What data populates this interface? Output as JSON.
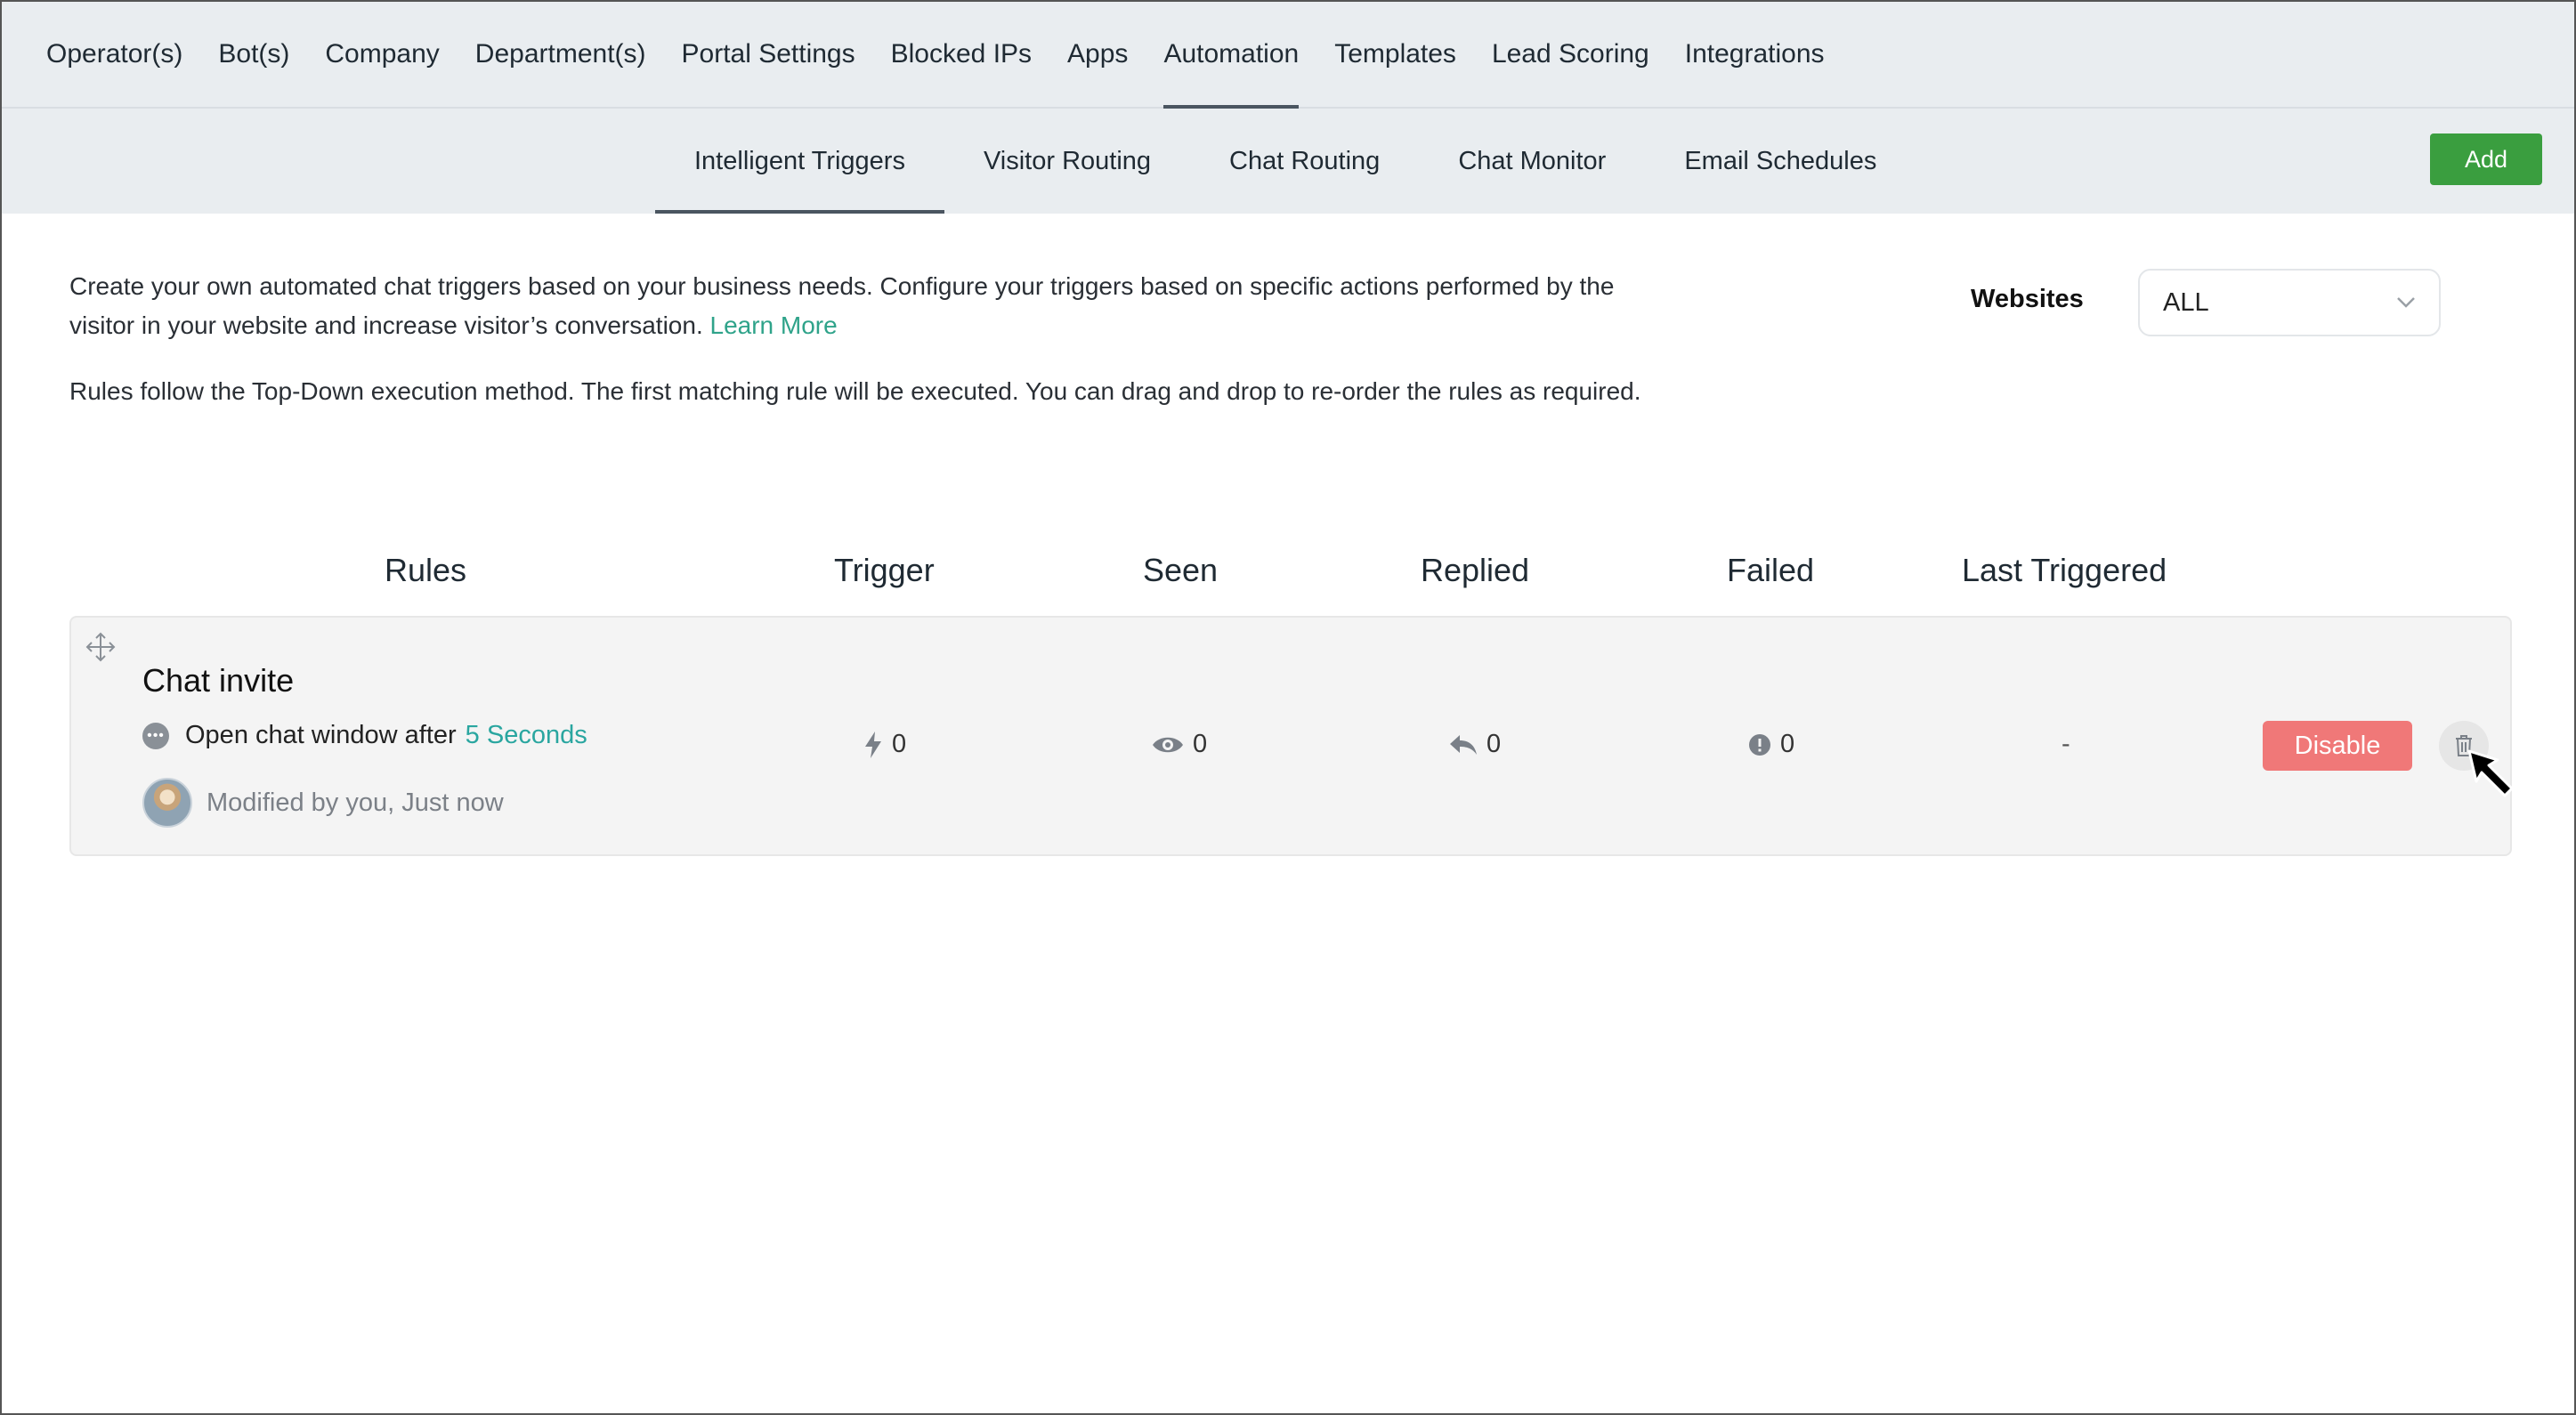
{
  "topnav": {
    "items": [
      "Operator(s)",
      "Bot(s)",
      "Company",
      "Department(s)",
      "Portal Settings",
      "Blocked IPs",
      "Apps",
      "Automation",
      "Templates",
      "Lead Scoring",
      "Integrations"
    ],
    "active": "Automation"
  },
  "subnav": {
    "tabs": [
      "Intelligent Triggers",
      "Visitor Routing",
      "Chat Routing",
      "Chat Monitor",
      "Email Schedules"
    ],
    "active": "Intelligent Triggers",
    "add_label": "Add"
  },
  "intro": {
    "para1": "Create your own automated chat triggers based on your business needs. Configure your triggers based on specific actions performed by the visitor in your website and increase visitor’s conversation.",
    "learn_more": "Learn More",
    "para2": "Rules follow the Top-Down execution method. The first matching rule will be executed. You can drag and drop to re-order the rules as required."
  },
  "websites": {
    "label": "Websites",
    "selected": "ALL"
  },
  "table": {
    "headers": {
      "rules": "Rules",
      "trigger": "Trigger",
      "seen": "Seen",
      "replied": "Replied",
      "failed": "Failed",
      "last_triggered": "Last Triggered"
    }
  },
  "rule": {
    "title": "Chat invite",
    "action_text": "Open chat window after",
    "action_value": "5 Seconds",
    "modified": "Modified by you, Just now",
    "trigger": "0",
    "seen": "0",
    "replied": "0",
    "failed": "0",
    "last_triggered": "-",
    "disable_label": "Disable"
  },
  "colors": {
    "nav_bg": "#e9edf0",
    "add_green": "#3a9e3f",
    "disable_red": "#f07878",
    "link_teal": "#2aa6a0"
  },
  "icons": [
    "move-icon",
    "chat-bubble-icon",
    "lightning-icon",
    "eye-icon",
    "reply-icon",
    "exclamation-icon",
    "trash-icon",
    "chevron-down-icon",
    "cursor-arrow-icon"
  ]
}
